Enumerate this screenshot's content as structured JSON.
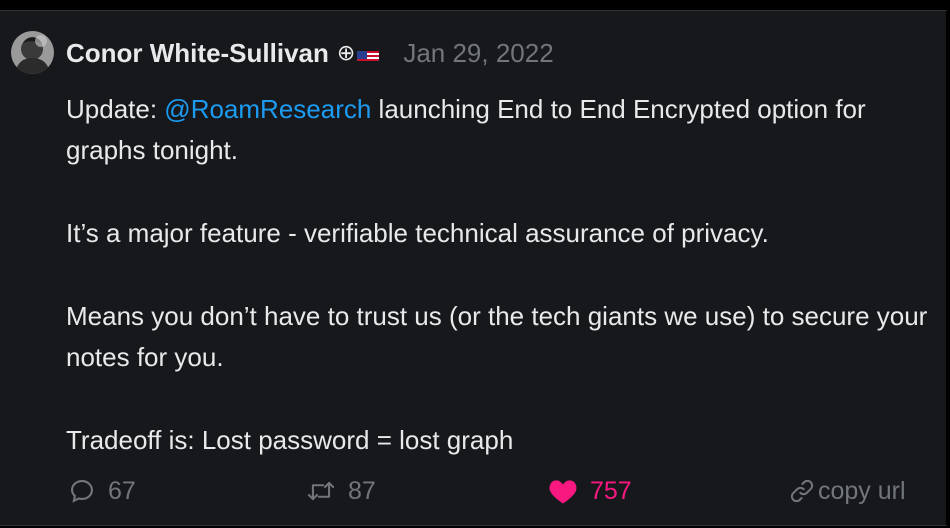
{
  "tweet": {
    "author": {
      "name": "Conor White-Sullivan",
      "badge_symbol": "⊕"
    },
    "date": "Jan 29, 2022",
    "text": {
      "line1_prefix": "Update: ",
      "mention": "@RoamResearch",
      "line1_suffix": " launching End to End Encrypted option for graphs tonight.",
      "para2": "It’s a major feature - verifiable technical assurance of privacy.",
      "para3": "Means you don’t have to trust us (or the tech giants we use) to secure your notes for you.",
      "para4": "Tradeoff is: Lost password = lost graph"
    }
  },
  "actions": {
    "reply_count": "67",
    "retweet_count": "87",
    "like_count": "757",
    "copy_label": "copy url"
  },
  "colors": {
    "background": "#16181c",
    "text": "#e7e9ea",
    "muted": "#71767b",
    "link": "#1d9bf0",
    "like": "#f91880"
  },
  "icons": [
    "avatar",
    "us-flag-icon",
    "reply-icon",
    "retweet-icon",
    "heart-icon",
    "link-icon"
  ]
}
